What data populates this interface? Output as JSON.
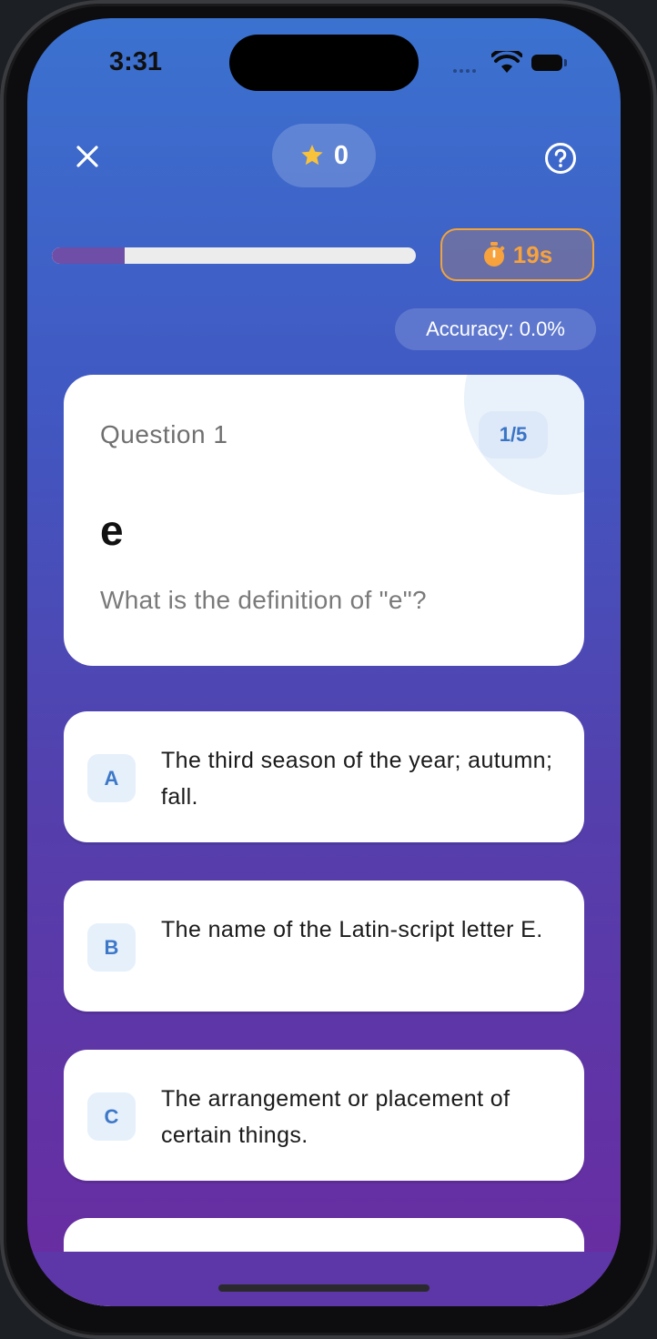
{
  "status_bar": {
    "time": "3:31"
  },
  "header": {
    "close_icon": "close-icon",
    "score": "0",
    "score_icon": "star-icon",
    "help_icon": "question-circle-icon"
  },
  "progress": {
    "fraction": 0.2
  },
  "timer": {
    "value": "19s",
    "icon": "stopwatch-icon"
  },
  "accuracy": {
    "label": "Accuracy: 0.0%"
  },
  "question": {
    "label": "Question 1",
    "counter": "1/5",
    "term": "e",
    "prompt": "What is the definition of \"e\"?"
  },
  "options": [
    {
      "letter": "A",
      "text": "The third season of the year; autumn; fall."
    },
    {
      "letter": "B",
      "text": "The name of the Latin-script letter E."
    },
    {
      "letter": "C",
      "text": "The arrangement or placement of certain things."
    }
  ],
  "colors": {
    "accent": "#3a74c6",
    "timer": "#f7a23c",
    "star": "#f8c23a",
    "progress_fill": "#6e4ea6"
  }
}
